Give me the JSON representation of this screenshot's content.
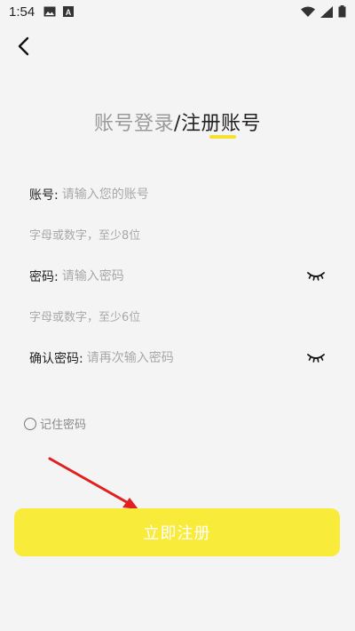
{
  "status_bar": {
    "time": "1:54",
    "left_icons": [
      "image-icon",
      "a-badge-icon"
    ],
    "right_icons": [
      "wifi-icon",
      "signal-icon",
      "battery-icon"
    ]
  },
  "header": {
    "back_icon": "chevron-left-icon",
    "tab_login": "账号登录",
    "separator": "/",
    "tab_register": "注册账号",
    "accent_color": "#f5e22c"
  },
  "form": {
    "account": {
      "label": "账号:",
      "placeholder": "请输入您的账号",
      "hint": "字母或数字，至少8位"
    },
    "password": {
      "label": "密码:",
      "placeholder": "请输入密码",
      "hint": "字母或数字，至少6位",
      "toggle_icon": "eye-closed-icon"
    },
    "confirm_password": {
      "label": "确认密码:",
      "placeholder": "请再次输入密码",
      "toggle_icon": "eye-closed-icon"
    },
    "remember_label": "记住密码"
  },
  "submit": {
    "label": "立即注册",
    "color": "#f8eb3a"
  }
}
